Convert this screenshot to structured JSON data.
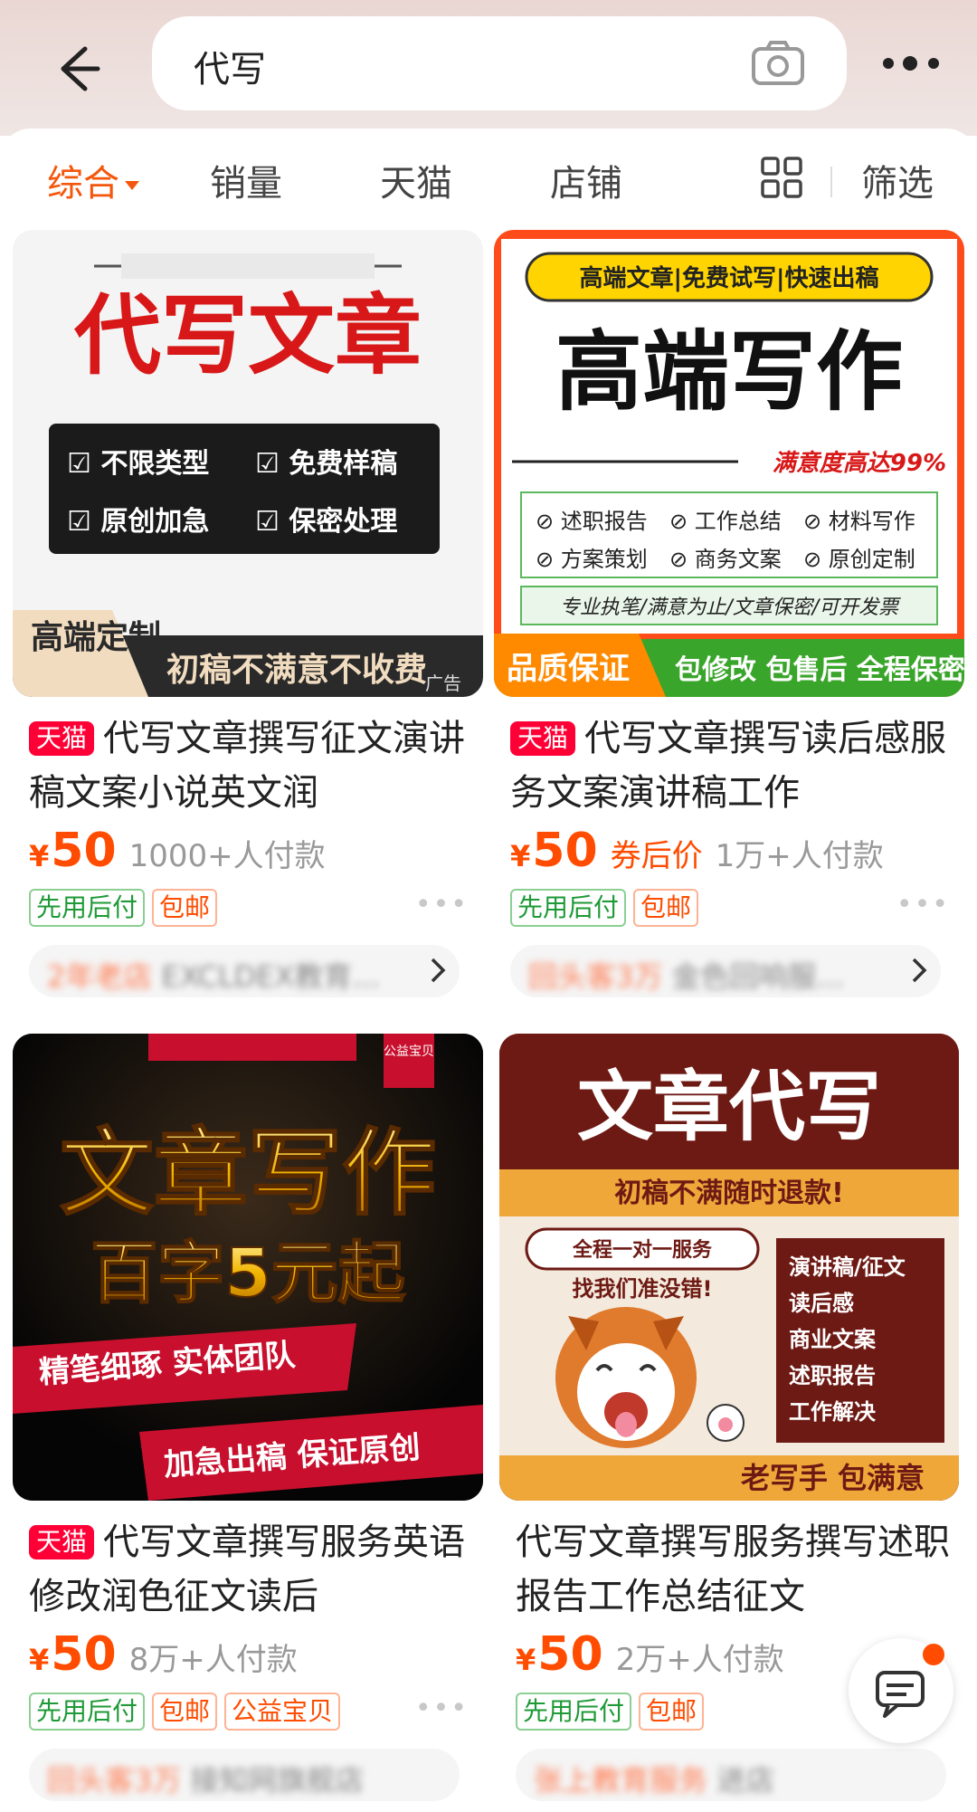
{
  "header": {
    "search_query": "代写"
  },
  "filters": {
    "tabs": [
      "综合",
      "销量",
      "天猫",
      "店铺"
    ],
    "filter_label": "筛选"
  },
  "products": [
    {
      "badge": "天猫",
      "title": "代写文章撰写征文演讲稿文案小说英文润",
      "currency": "¥",
      "price": "50",
      "coupon_label": "",
      "sold": "1000+人付款",
      "tags": [
        "先用后付",
        "包邮"
      ],
      "shop": "2年老店 EXCLDEX教育...",
      "image": {
        "headline": "代写文章",
        "items": [
          "不限类型",
          "免费样稿",
          "原创加急",
          "保密处理"
        ],
        "corner_label": "高端定制",
        "footer": "初稿不满意不收费",
        "ad_label": "广告"
      }
    },
    {
      "badge": "天猫",
      "title": "代写文章撰写读后感服务文案演讲稿工作",
      "currency": "¥",
      "price": "50",
      "coupon_label": "券后价",
      "sold": "1万+人付款",
      "tags": [
        "先用后付",
        "包邮"
      ],
      "shop": "回头客3万 金色回响服...",
      "image": {
        "top_banner": "高端文章|免费试写|快速出稿",
        "headline": "高端写作",
        "satisfaction": "满意度高达99%",
        "items": [
          "述职报告",
          "工作总结",
          "材料写作",
          "方案策划",
          "商务文案",
          "原创定制"
        ],
        "slogan": "专业执笔/满意为止/文章保密/可开发票",
        "corner_label": "品质保证",
        "footer": "包修改 包售后 全程保密"
      }
    },
    {
      "badge": "天猫",
      "title": "代写文章撰写服务英语修改润色征文读后",
      "currency": "¥",
      "price": "50",
      "coupon_label": "",
      "sold": "8万+人付款",
      "tags": [
        "先用后付",
        "包邮",
        "公益宝贝"
      ],
      "shop": "回头客3万 接知网旗舰店",
      "image": {
        "charity_label": "公益宝贝",
        "headline": "文章写作",
        "subheadline": "百字5元起",
        "slogan1": "精笔细琢 实体团队",
        "slogan2": "加急出稿 保证原创"
      }
    },
    {
      "badge": "",
      "title": "代写文章撰写服务撰写述职报告工作总结征文",
      "currency": "¥",
      "price": "50",
      "coupon_label": "",
      "sold": "2万+人付款",
      "tags": [
        "先用后付",
        "包邮"
      ],
      "shop": "张上教育服务 进店",
      "image": {
        "headline": "文章代写",
        "subheadline": "初稿不满随时退款!",
        "bubble1": "全程一对一服务",
        "bubble2": "找我们准没错!",
        "items": [
          "演讲稿/征文",
          "读后感",
          "商业文案",
          "述职报告",
          "工作解决"
        ],
        "footer": "老写手 包满意"
      }
    }
  ],
  "colors": {
    "accent": "#f4560c",
    "price": "#ff4c00",
    "tmall": "#ff0036",
    "green_tag": "#1e9a36"
  }
}
